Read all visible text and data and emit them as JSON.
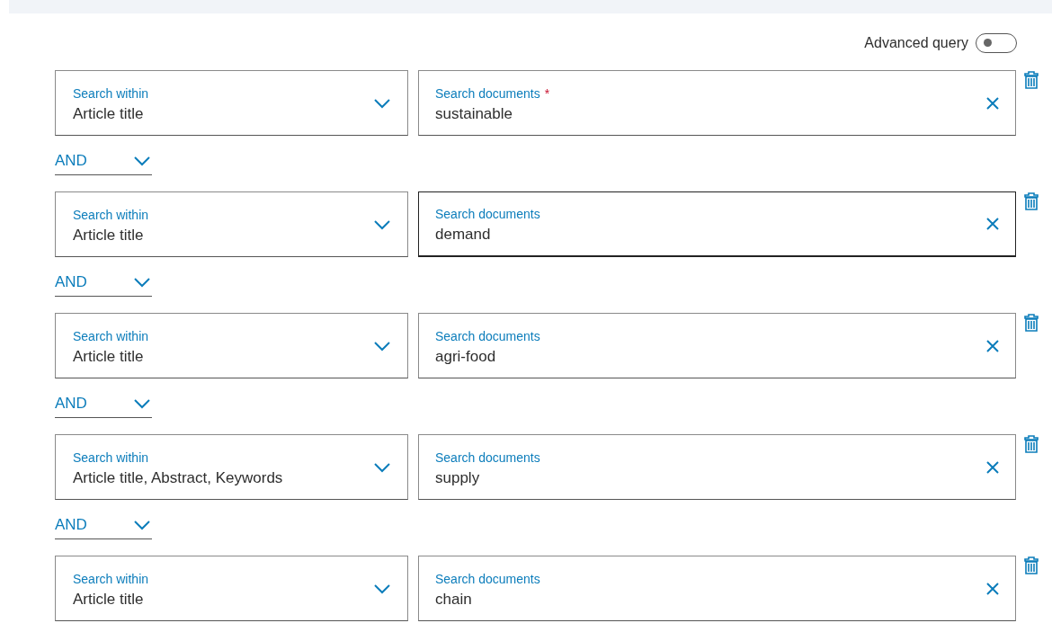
{
  "advanced_query": {
    "label": "Advanced query",
    "on": false
  },
  "rows": [
    {
      "within_label": "Search within",
      "within_value": "Article title",
      "query_label": "Search documents",
      "required_mark": "*",
      "query_value": "sustainable",
      "focused": false,
      "operator": "AND"
    },
    {
      "within_label": "Search within",
      "within_value": "Article title",
      "query_label": "Search documents",
      "query_value": "demand",
      "focused": true,
      "operator": "AND"
    },
    {
      "within_label": "Search within",
      "within_value": "Article title",
      "query_label": "Search documents",
      "query_value": "agri-food",
      "focused": false,
      "operator": "AND"
    },
    {
      "within_label": "Search within",
      "within_value": "Article title, Abstract, Keywords",
      "query_label": "Search documents",
      "query_value": "supply",
      "focused": false,
      "operator": "AND"
    },
    {
      "within_label": "Search within",
      "within_value": "Article title",
      "query_label": "Search documents",
      "query_value": "chain",
      "focused": false
    }
  ]
}
